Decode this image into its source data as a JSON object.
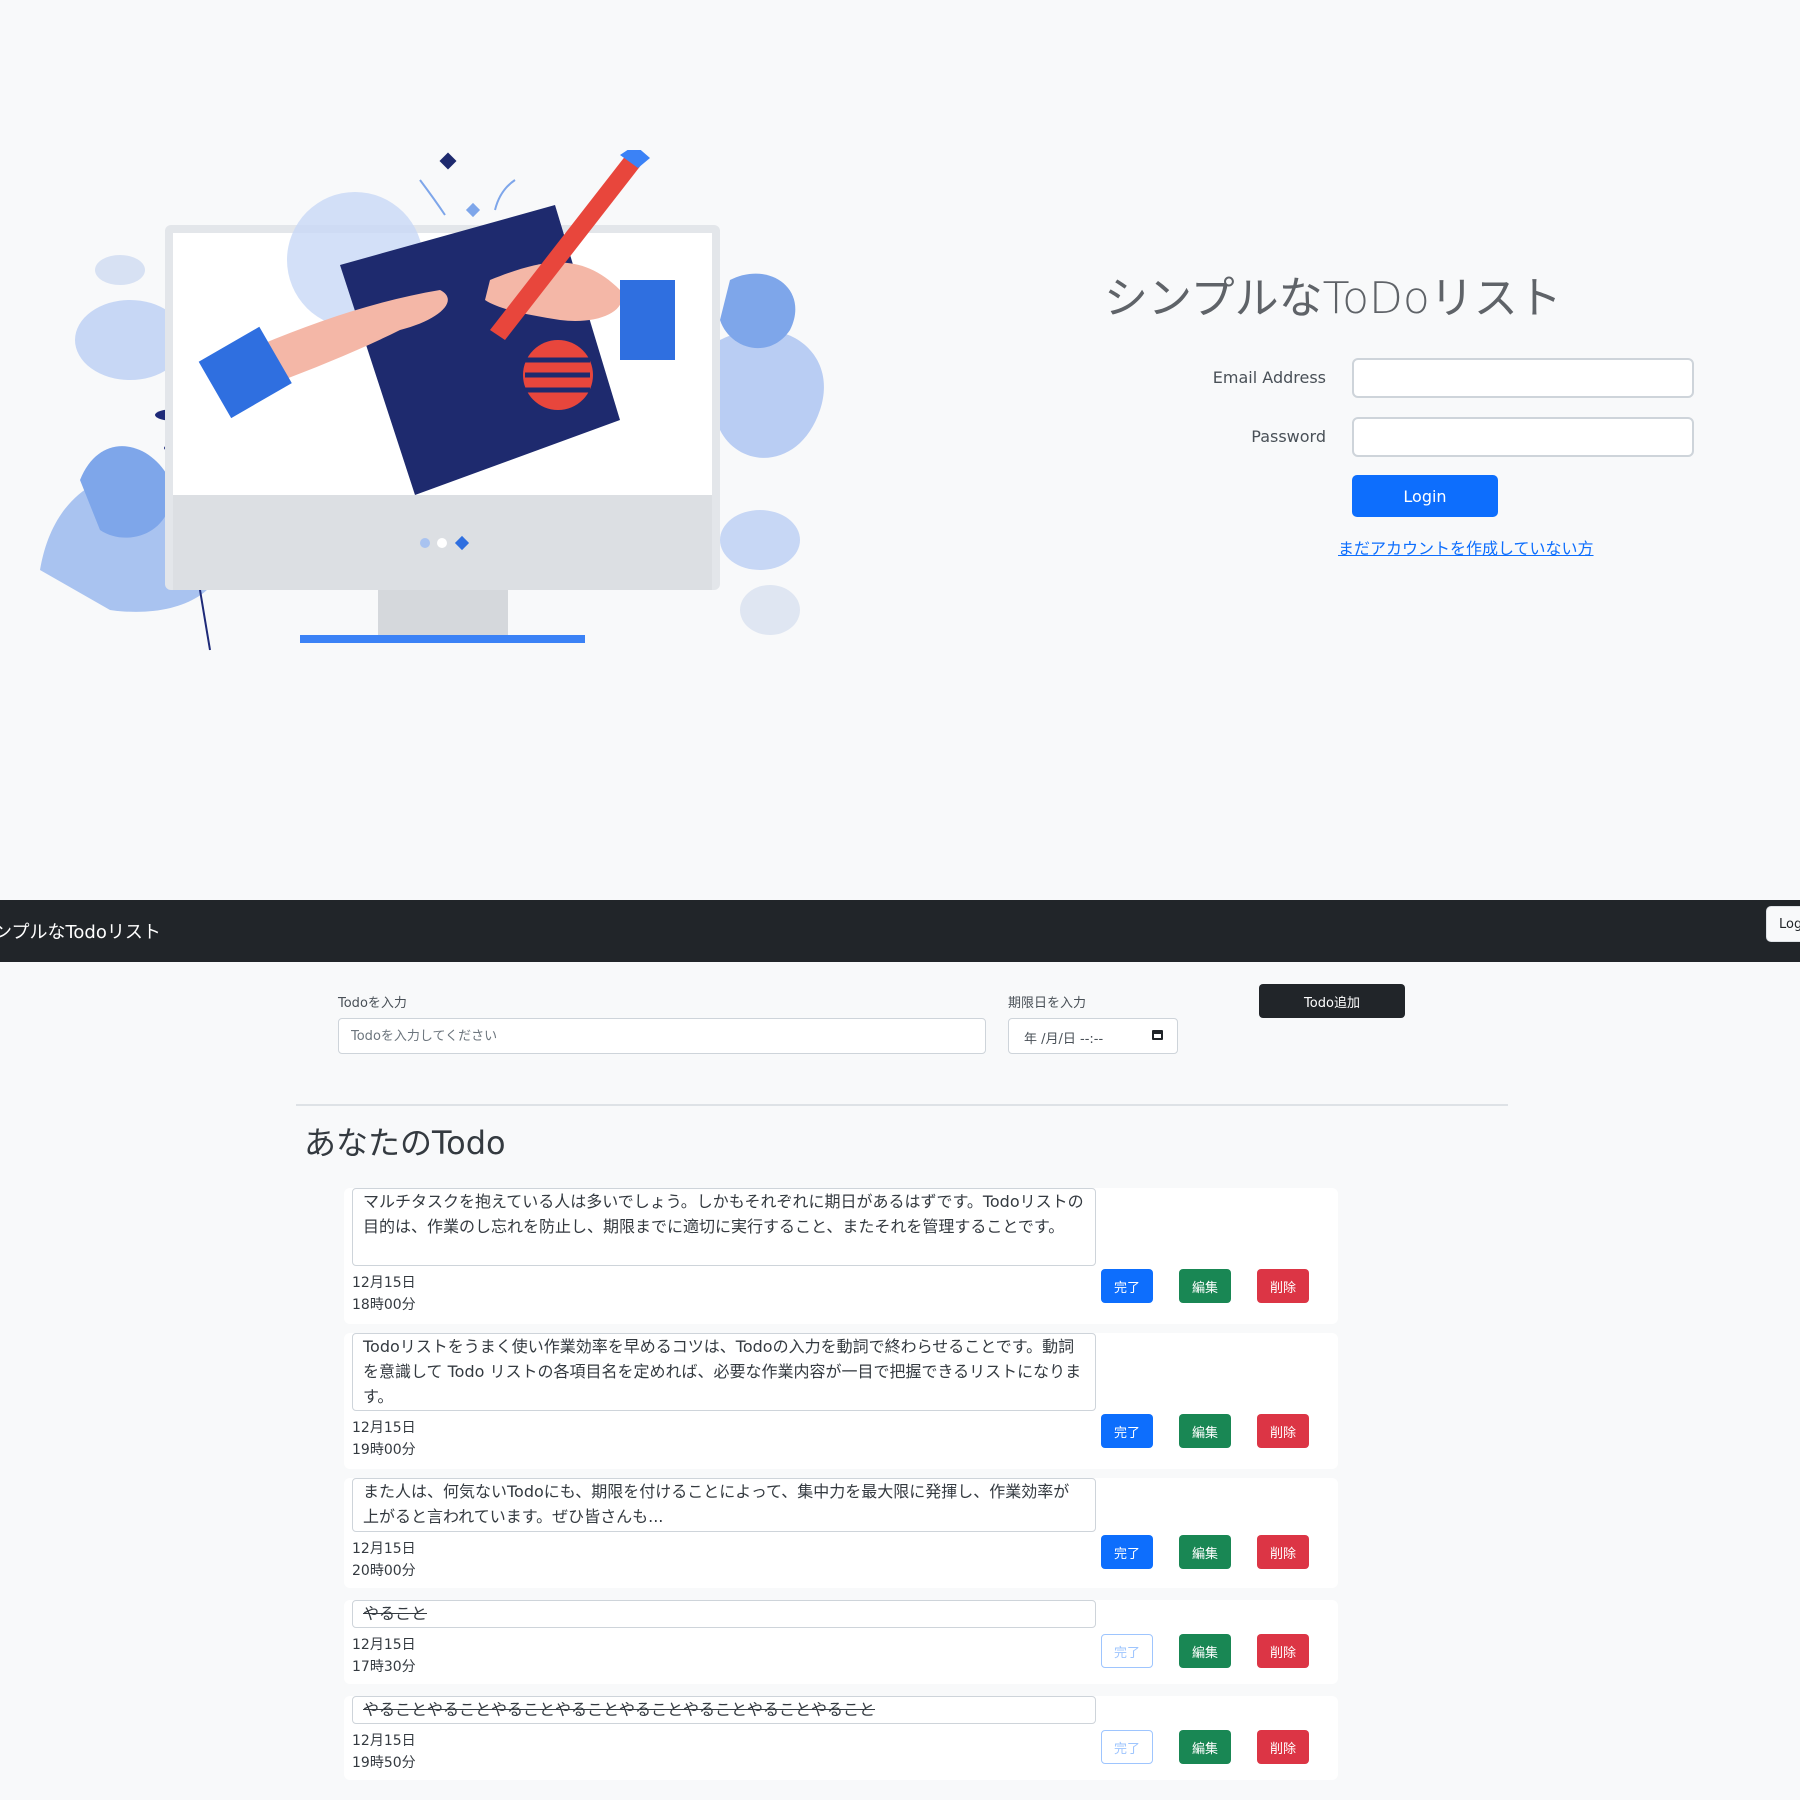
{
  "login": {
    "title": "シンプルなToDoリスト",
    "email_label": "Email Address",
    "email_value": "",
    "password_label": "Password",
    "password_value": "",
    "login_button": "Login",
    "signup_link": "まだアカウントを作成していない方"
  },
  "app": {
    "navbar": {
      "brand": "シンプルなTodoリスト",
      "logout_button": "Logout"
    },
    "form": {
      "todo_label": "Todoを入力",
      "todo_placeholder": "Todoを入力してください",
      "due_label": "期限日を入力",
      "due_placeholder": "年 /月/日 --:--",
      "add_button": "Todo追加"
    },
    "list_title": "あなたのTodo",
    "button_labels": {
      "complete": "完了",
      "edit": "編集",
      "delete": "削除"
    },
    "todos": [
      {
        "text": "マルチタスクを抱えている人は多いでしょう。しかもそれぞれに期日があるはずです。Todoリストの目的は、作業のし忘れを防止し、期限までに適切に実行すること、またそれを管理することです。",
        "date": "12月15日",
        "time": "18時00分",
        "completed": false
      },
      {
        "text": "Todoリストをうまく使い作業効率を早めるコツは、Todoの入力を動詞で終わらせることです。動詞を意識して Todo リストの各項目名を定めれば、必要な作業内容が一目で把握できるリストになります。",
        "date": "12月15日",
        "time": "19時00分",
        "completed": false
      },
      {
        "text": "また人は、何気ないTodoにも、期限を付けることによって、集中力を最大限に発揮し、作業効率が上がると言われています。ぜひ皆さんも...",
        "date": "12月15日",
        "time": "20時00分",
        "completed": false
      },
      {
        "text": "やること",
        "date": "12月15日",
        "time": "17時30分",
        "completed": true
      },
      {
        "text": "やることやることやることやることやることやることやることやること",
        "date": "12月15日",
        "time": "19時50分",
        "completed": true
      }
    ]
  }
}
